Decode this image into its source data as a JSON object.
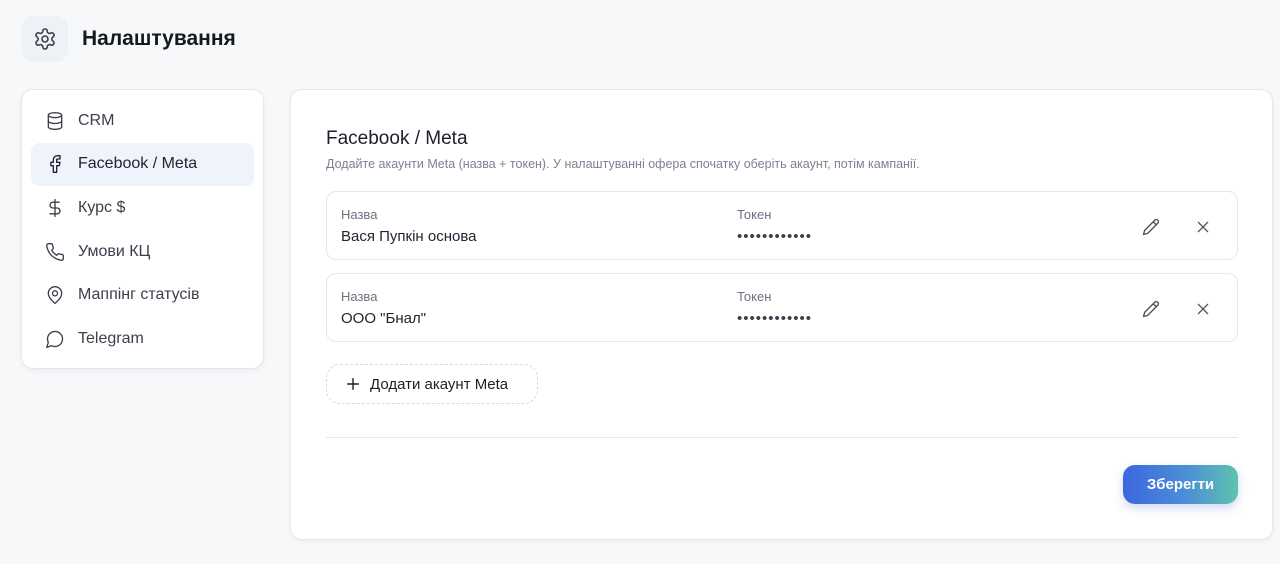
{
  "header": {
    "title": "Налаштування",
    "icon": "gear-icon"
  },
  "sidebar": {
    "items": [
      {
        "label": "CRM",
        "icon": "database-icon",
        "active": false
      },
      {
        "label": "Facebook / Meta",
        "icon": "facebook-icon",
        "active": true
      },
      {
        "label": "Курс $",
        "icon": "dollar-icon",
        "active": false
      },
      {
        "label": "Умови КЦ",
        "icon": "phone-icon",
        "active": false
      },
      {
        "label": "Маппінг статусів",
        "icon": "map-pin-icon",
        "active": false
      },
      {
        "label": "Telegram",
        "icon": "message-icon",
        "active": false
      }
    ]
  },
  "main": {
    "title": "Facebook / Meta",
    "description": "Додайте акаунти Meta (назва + токен). У налаштуванні офера спочатку оберіть акаунт, потім кампанії.",
    "accounts": [
      {
        "name_label": "Назва",
        "name": "Вася Пупкін основа",
        "token_label": "Токен",
        "token": "••••••••••••"
      },
      {
        "name_label": "Назва",
        "name": "ООО \"Бнал\"",
        "token_label": "Токен",
        "token": "••••••••••••"
      }
    ],
    "add_button": "Додати акаунт Meta",
    "save_button": "Зберегти"
  },
  "colors": {
    "accent_start": "#3d66e0",
    "accent_end": "#5fc2b0",
    "active_nav_bg": "#eff4fc"
  }
}
